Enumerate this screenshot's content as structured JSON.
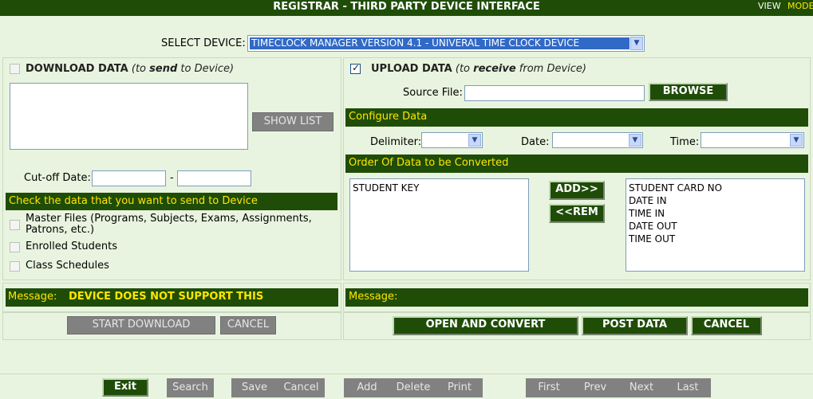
{
  "header": {
    "title": "REGISTRAR - THIRD PARTY DEVICE INTERFACE",
    "view": "VIEW",
    "mode": "MODE"
  },
  "device": {
    "label": "SELECT DEVICE:",
    "selected": "TIMECLOCK MANAGER VERSION 4.1 - UNIVERAL TIME CLOCK DEVICE"
  },
  "download": {
    "title": "DOWNLOAD DATA",
    "sub_pre": "(to ",
    "sub_em": "send",
    "sub_post": " to Device)",
    "show_list": "SHOW LIST",
    "cutoff_label": "Cut-off Date:",
    "dash": "-",
    "check_header": "Check the data that you want to send to Device",
    "options": [
      "Master Files (Programs, Subjects, Exams, Assignments, Patrons, etc.)",
      "Enrolled Students",
      "Class Schedules"
    ],
    "message_label": "Message:",
    "message": "DEVICE DOES NOT SUPPORT THIS",
    "start_btn": "START DOWNLOAD",
    "cancel_btn": "CANCEL"
  },
  "upload": {
    "title": "UPLOAD DATA",
    "sub_pre": "(to ",
    "sub_em": "receive",
    "sub_post": " from Device)",
    "source_label": "Source File:",
    "browse_btn": "BROWSE",
    "config_header": "Configure Data",
    "delimiter_label": "Delimiter:",
    "date_label": "Date:",
    "time_label": "Time:",
    "order_header": "Order Of Data to be Converted",
    "left_list": [
      "STUDENT KEY"
    ],
    "right_list": [
      "STUDENT CARD NO",
      "DATE IN",
      "TIME IN",
      "DATE OUT",
      "TIME OUT"
    ],
    "add_btn": "ADD>>",
    "rem_btn": "<<REM",
    "message_label": "Message:",
    "open_btn": "OPEN AND CONVERT",
    "post_btn": "POST DATA",
    "cancel_btn": "CANCEL"
  },
  "footer": {
    "exit": "Exit",
    "search": "Search",
    "save": "Save",
    "cancel": "Cancel",
    "add": "Add",
    "delete": "Delete",
    "print": "Print",
    "first": "First",
    "prev": "Prev",
    "next": "Next",
    "last": "Last"
  }
}
